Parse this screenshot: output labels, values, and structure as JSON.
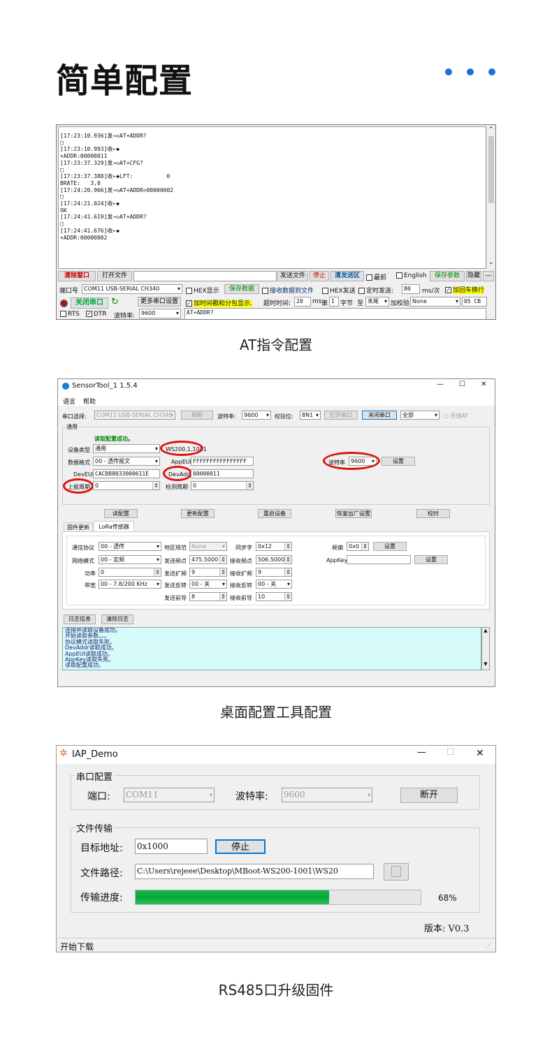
{
  "header": {
    "title": "简单配置"
  },
  "captions": {
    "at": "AT指令配置",
    "tool": "桌面配置工具配置",
    "iap": "RS485口升级固件"
  },
  "serial": {
    "log": [
      "[17:23:10.936]发→◇AT+ADDR?",
      "□",
      "[17:23:10.993]收←◆",
      "+ADDR:00000011",
      "",
      "[17:23:37.329]发→◇AT+CFG?",
      "□",
      "[17:23:37.388]收←◆LFT:          0",
      "BRATE:   3,0",
      "",
      "[17:24:20.966]发→◇AT+ADDR=00000002",
      "□",
      "[17:24:21.024]收←◆",
      "OK",
      "",
      "[17:24:41.619]发→◇AT+ADDR?",
      "□",
      "[17:24:41.676]收←◆",
      "+ADDR:00000002"
    ],
    "clear_window": "清除窗口",
    "open_file": "打开文件",
    "send_file": "发送文件",
    "stop": "停止",
    "clear_send": "清发送区",
    "topmost": "最前",
    "english": "English",
    "save_params": "保存参数",
    "hide": "隐藏",
    "minus": "—",
    "port_label": "端口号",
    "port_value": "COM11 USB-SERIAL CH340",
    "hex_display": "HEX显示",
    "save_data": "保存数据",
    "recv_to_file": "接收数据到文件",
    "hex_send": "HEX发送",
    "timed_send": "定时发送:",
    "interval": "80",
    "interval_unit": "ms/次",
    "crlf": "加回车换行",
    "close_port": "关闭串口",
    "more_ports": "更多串口设置",
    "timestamp": "加时间戳和分包显示.",
    "timeout": "超时时间:",
    "timeout_val": "20",
    "ms": "ms",
    "nth": "第",
    "nth_val": "1",
    "byte": "字节",
    "to": "至",
    "end": "末尾",
    "checksum": "加校验",
    "checksum_val": "None",
    "hexbyte": "05 CB",
    "rts": "RTS",
    "dtr": "DTR",
    "baud_label": "波特率:",
    "baud_value": "9600",
    "send_text": "AT+ADDR?"
  },
  "sensortool": {
    "title": "SensorTool_1 1.5.4",
    "menu": [
      "语言",
      "帮助"
    ],
    "port_label": "串口选择:",
    "port": "COM11 USB-SERIAL CH340",
    "refresh": "刷新",
    "baud_label": "波特率:",
    "baud": "9600",
    "parity_label": "校验位:",
    "parity": "8N1",
    "open": "打开串口",
    "close": "关闭串口",
    "all": "全部",
    "no_at": "无线AT",
    "group_general": "通用",
    "read_ok": "读取配置成功。",
    "device_type_label": "设备类型",
    "device_type": "通用",
    "model": "WS200,1,1001",
    "format_label": "数据格式",
    "format": "00 - 透传报文",
    "appeui_label": "AppEUI",
    "appeui": "FFFFFFFFFFFFFFFF",
    "baud2_label": "波特率",
    "baud2": "9600",
    "set": "设置",
    "deveui_label": "DevEUI",
    "deveui": "CACB88033000611E",
    "devaddr_label": "DevAddr",
    "devaddr": "00000011",
    "report_label": "上报周期",
    "report": "0",
    "detect_label": "检测周期",
    "detect": "0",
    "buttons": [
      "读配置",
      "更新配置",
      "重启设备",
      "恢复出厂设置",
      "校时"
    ],
    "tabs": [
      "固件更新",
      "LoRa传感器"
    ],
    "proto_label": "通信协议",
    "proto": "00 - 透传",
    "region_label": "地区规范",
    "region": "None",
    "sync_label": "同步字",
    "sync": "0x12",
    "freq_label": "频偏",
    "freq": "0x0",
    "netmode_label": "网络模式",
    "netmode": "00 - 定频",
    "txfreq_label": "发送频点",
    "txfreq": "475.5000",
    "rxfreq_label": "接收频点",
    "rxfreq": "506.5000",
    "appkey_label": "AppKey",
    "power_label": "功率",
    "power": "0",
    "txsf_label": "发送扩频",
    "txsf": "9",
    "rxsf_label": "接收扩频",
    "rxsf": "9",
    "bw_label": "带宽",
    "bw": "00 - 7.8/200 KHz",
    "txinv_label": "发送反转",
    "txinv": "00 - 关",
    "rxinv_label": "接收反转",
    "rxinv": "00 - 关",
    "txpre_label": "发送前导",
    "txpre": "8",
    "rxpre_label": "接收前导",
    "rxpre": "10",
    "log_info": "日志信息",
    "clear_log": "清除日志",
    "log": [
      "连接并读取设备成功。",
      "开始读取参数。。。",
      "协议模式读取失败。",
      "DevAddr读取成功。",
      "AppEUI读取成功。",
      "AppKey读取失败。",
      "读取配置成功。"
    ]
  },
  "iap": {
    "title": "IAP_Demo",
    "group_port": "串口配置",
    "port_label": "端口:",
    "port": "COM11",
    "baud_label": "波特率:",
    "baud": "9600",
    "disconnect": "断开",
    "group_file": "文件传输",
    "target_label": "目标地址:",
    "target": "0x1000",
    "stop": "停止",
    "path_label": "文件路径:",
    "path": "C:\\Users\\rejeee\\Desktop\\MBoot-WS200-1001\\WS20",
    "progress_label": "传输进度:",
    "progress_text": "68%",
    "progress": 0.68,
    "version": "版本: V0.3",
    "status": "开始下载"
  }
}
